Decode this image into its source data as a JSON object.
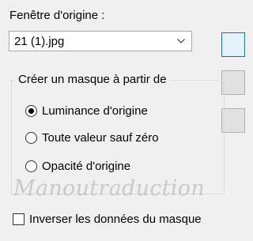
{
  "source": {
    "label": "Fenêtre d'origine :",
    "selected_value": "21 (1).jpg"
  },
  "mask_group": {
    "caption": "Créer un masque à partir de",
    "options": [
      {
        "label": "Luminance d'origine",
        "checked": true
      },
      {
        "label": "Toute valeur sauf zéro",
        "checked": false
      },
      {
        "label": "Opacité d'origine",
        "checked": false
      }
    ]
  },
  "watermark": {
    "text": "Manoutraduction"
  },
  "invert": {
    "label": "Inverser les données du masque",
    "checked": false
  },
  "icons": {
    "dropdown": "chevron-down-icon"
  },
  "colors": {
    "background": "#f0f0f0",
    "focus_border": "#0078d7"
  }
}
